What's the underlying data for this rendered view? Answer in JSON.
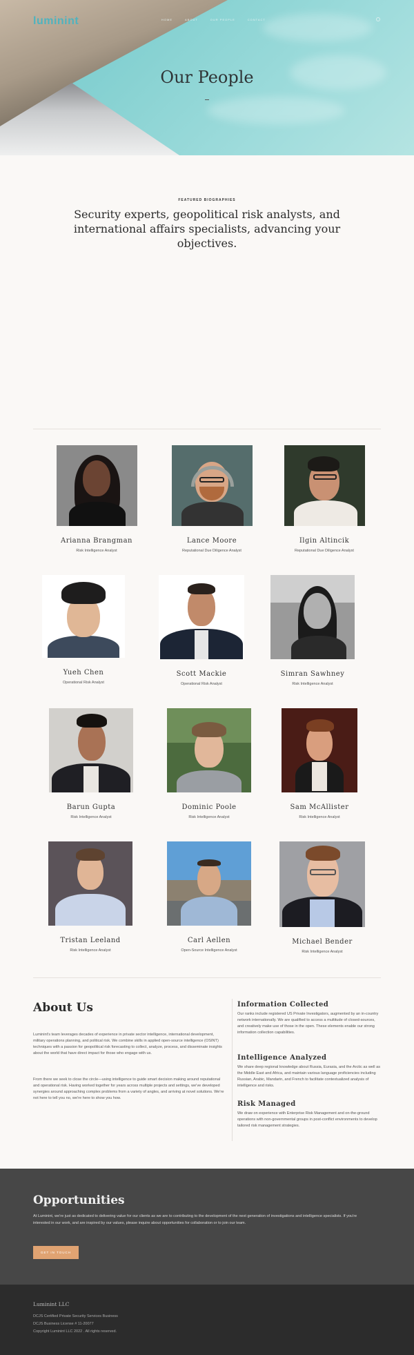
{
  "nav": {
    "logo": "luminint",
    "links": [
      "HOME",
      "ABOUT",
      "OUR PEOPLE",
      "CONTACT"
    ]
  },
  "hero": {
    "title": "Our People"
  },
  "featured": {
    "eyebrow": "FEATURED BIOGRAPHIES",
    "headline": "Security experts, geopolitical risk analysts, and international affairs specialists, advancing your objectives."
  },
  "people": [
    {
      "name": "Arianna Brangman",
      "role": "Risk Intelligence Analyst"
    },
    {
      "name": "Lance Moore",
      "role": "Reputational Due Diligence Analyst"
    },
    {
      "name": "Ilgin Altincik",
      "role": "Reputational Due Diligence Analyst"
    },
    {
      "name": "Yueh Chen",
      "role": "Operational Risk Analyst"
    },
    {
      "name": "Scott Mackie",
      "role": "Operational Risk Analyst"
    },
    {
      "name": "Simran Sawhney",
      "role": "Risk Intelligence Analyst"
    },
    {
      "name": "Barun Gupta",
      "role": "Risk Intelligence Analyst"
    },
    {
      "name": "Dominic Poole",
      "role": "Risk Intelligence Analyst"
    },
    {
      "name": "Sam McAllister",
      "role": "Risk Intelligence Analyst"
    },
    {
      "name": "Tristan Leeland",
      "role": "Risk Intelligence Analyst"
    },
    {
      "name": "Carl Aellen",
      "role": "Open-Source Intelligence Analyst"
    },
    {
      "name": "Michael Bender",
      "role": "Risk Intelligence Analyst"
    }
  ],
  "about": {
    "title": "About Us",
    "p1": "Luminint's team leverages decades of experience in private sector intelligence, international development, military operations planning, and political risk. We combine skills in applied open-source intelligence (OSINT) techniques with a passion for geopolitical risk forecasting to collect, analyze, process, and disseminate insights about the world that have direct impact for those who engage with us.",
    "p2": "From there we seek to close the circle—using intelligence to guide smart decision making around reputational and operational risk. Having worked together for years across multiple projects and settings, we've developed synergies around approaching complex problems from a variety of angles, and arriving at novel solutions. We're not here to tell you no, we're here to show you how.",
    "sections": [
      {
        "title": "Information Collected",
        "text": "Our ranks include registered US Private Investigators, augmented by an in-country network internationally. We are qualified to access a multitude of closed-sources, and creatively make use of those in the open. These elements enable our strong information collection capabilities."
      },
      {
        "title": "Intelligence Analyzed",
        "text": "We share deep regional knowledge about Russia, Eurasia, and the Arctic as well as the Middle East and Africa, and maintain various language proficiencies including Russian, Arabic, Mandarin, and French to facilitate contextualized analysis of intelligence and risks."
      },
      {
        "title": "Risk Managed",
        "text": "We draw on experience with Enterprise Risk Management and on-the-ground operations with non-governmental groups in post-conflict environments to develop tailored risk management strategies."
      }
    ]
  },
  "opportunities": {
    "title": "Opportunities",
    "text": "At Luminint, we're just as dedicated to delivering value for our clients as we are to contributing to the development of the next generation of investigations and intelligence specialists. If you're interested in our work, and are inspired by our values, please inquire about opportunities for collaboration or to join our team.",
    "button": "GET IN TOUCH"
  },
  "footer": {
    "company": "Luminint LLC",
    "line1": "DCJS Certified Private Security Services Business",
    "line2": "DCJS Business License # 11-20077",
    "line3": "Copyright Luminint LLC 2022 . All rights reserved."
  },
  "colors": {
    "accent": "#4fb3bf",
    "button": "#e0a372",
    "dark": "#474747",
    "footer": "#2c2c2c"
  }
}
